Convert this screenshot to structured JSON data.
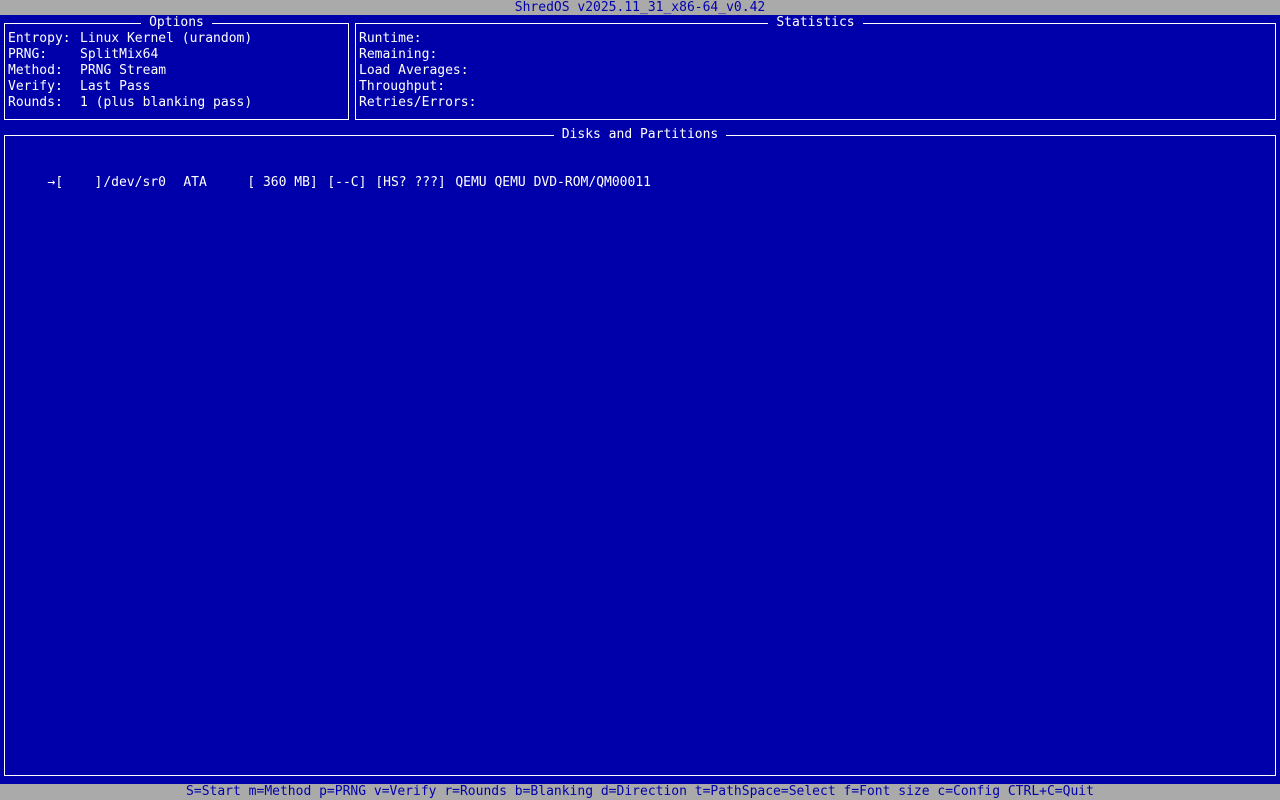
{
  "window": {
    "title": "ShredOS v2025.11_31_x86-64_v0.42"
  },
  "options": {
    "title": "Options",
    "items": [
      {
        "label": "Entropy:",
        "value": "Linux Kernel (urandom)"
      },
      {
        "label": "PRNG:",
        "value": "SplitMix64"
      },
      {
        "label": "Method:",
        "value": "PRNG Stream"
      },
      {
        "label": "Verify:",
        "value": "Last Pass"
      },
      {
        "label": "Rounds:",
        "value": "1 (plus blanking pass)"
      }
    ]
  },
  "statistics": {
    "title": "Statistics",
    "items": [
      {
        "label": "Runtime:",
        "value": ""
      },
      {
        "label": "Remaining:",
        "value": ""
      },
      {
        "label": "Load Averages:",
        "value": ""
      },
      {
        "label": "Throughput:",
        "value": ""
      },
      {
        "label": "Retries/Errors:",
        "value": ""
      }
    ]
  },
  "disks": {
    "title": "Disks and Partitions",
    "items": [
      {
        "cursor": "→",
        "checkbox": "[    ]",
        "device": "/dev/sr0",
        "bus": "ATA",
        "size": "[ 360 MB]",
        "flags": "[--C]",
        "hs": "[HS? ???]",
        "model": "QEMU QEMU DVD-ROM/QM00011"
      }
    ]
  },
  "footer": {
    "shortcuts": "S=Start m=Method p=PRNG v=Verify r=Rounds b=Blanking d=Direction t=PathSpace=Select f=Font size c=Config CTRL+C=Quit"
  },
  "colors": {
    "background": "#0000aa",
    "bar": "#aaaaaa",
    "text": "#ffffff"
  }
}
